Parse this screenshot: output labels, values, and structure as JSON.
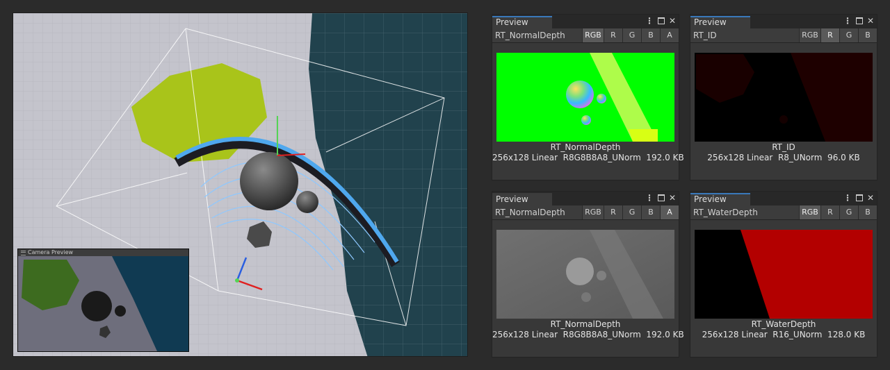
{
  "scene": {
    "camera_preview_title": "Camera Preview"
  },
  "panels": [
    {
      "tab": "Preview",
      "texture_name": "RT_NormalDepth",
      "channels": [
        {
          "label": "RGB",
          "active": true
        },
        {
          "label": "R",
          "active": false
        },
        {
          "label": "G",
          "active": false
        },
        {
          "label": "B",
          "active": false
        },
        {
          "label": "A",
          "active": false
        }
      ],
      "caption_name": "RT_NormalDepth",
      "caption_info": "256x128 Linear  R8G8B8A8_UNorm  192.0 KB"
    },
    {
      "tab": "Preview",
      "texture_name": "RT_ID",
      "channels": [
        {
          "label": "RGB",
          "active": false
        },
        {
          "label": "R",
          "active": true
        },
        {
          "label": "G",
          "active": false
        },
        {
          "label": "B",
          "active": false
        }
      ],
      "caption_name": "RT_ID",
      "caption_info": "256x128 Linear  R8_UNorm  96.0 KB"
    },
    {
      "tab": "Preview",
      "texture_name": "RT_NormalDepth",
      "channels": [
        {
          "label": "RGB",
          "active": false
        },
        {
          "label": "R",
          "active": false
        },
        {
          "label": "G",
          "active": false
        },
        {
          "label": "B",
          "active": false
        },
        {
          "label": "A",
          "active": true
        }
      ],
      "caption_name": "RT_NormalDepth",
      "caption_info": "256x128 Linear  R8G8B8A8_UNorm  192.0 KB"
    },
    {
      "tab": "Preview",
      "texture_name": "RT_WaterDepth",
      "channels": [
        {
          "label": "RGB",
          "active": true
        },
        {
          "label": "R",
          "active": false
        },
        {
          "label": "G",
          "active": false
        },
        {
          "label": "B",
          "active": false
        }
      ],
      "caption_name": "RT_WaterDepth",
      "caption_info": "256x128 Linear  R16_UNorm  128.0 KB"
    }
  ],
  "colors": {
    "accent_tab": "#3a79bb",
    "normal_green": "#00ff00",
    "id_red": "#1a0000",
    "water_red": "#b30000"
  }
}
